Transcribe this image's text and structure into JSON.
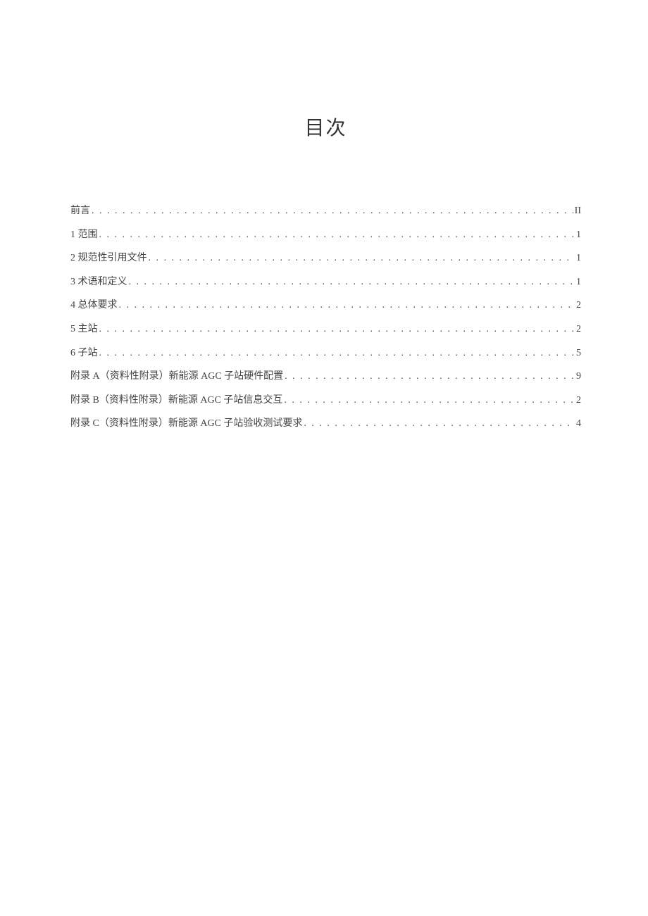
{
  "title": "目次",
  "toc_entries": [
    {
      "label": "前言",
      "page": "II"
    },
    {
      "label": "1 范围",
      "page": "1"
    },
    {
      "label": "2 规范性引用文件",
      "page": "1"
    },
    {
      "label": "3 术语和定义",
      "page": "1"
    },
    {
      "label": "4 总体要求",
      "page": "2"
    },
    {
      "label": "5 主站",
      "page": "2"
    },
    {
      "label": "6 子站",
      "page": "5"
    },
    {
      "label": "附录 A（资料性附录）新能源 AGC 子站硬件配置",
      "page": "9"
    },
    {
      "label": "附录 B（资料性附录）新能源 AGC 子站信息交互",
      "page": "2"
    },
    {
      "label": "附录 C（资料性附录）新能源 AGC 子站验收测试要求",
      "page": "4"
    }
  ]
}
